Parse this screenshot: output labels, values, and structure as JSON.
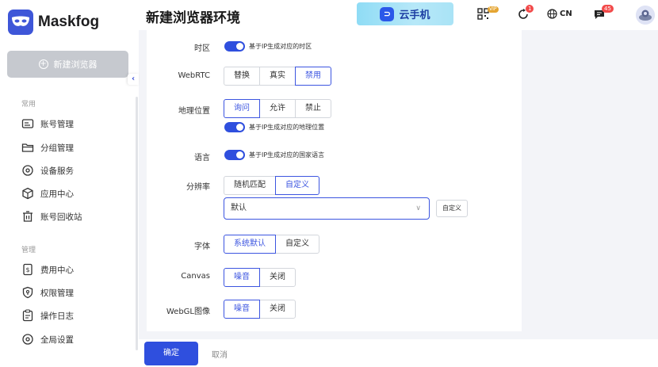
{
  "app": {
    "name": "Maskfog"
  },
  "sidebar": {
    "new_button": "新建浏览器",
    "sections": [
      {
        "title": "常用",
        "items": [
          "账号管理",
          "分组管理",
          "设备服务",
          "应用中心",
          "账号回收站"
        ]
      },
      {
        "title": "管理",
        "items": [
          "费用中心",
          "权限管理",
          "操作日志",
          "全局设置"
        ]
      }
    ]
  },
  "header": {
    "title": "新建浏览器环境",
    "cloud_phone": "云手机",
    "vip_badge": "VIP",
    "notify_badge": "1",
    "message_badge": "45",
    "language": "CN"
  },
  "form": {
    "timezone": {
      "label": "时区",
      "toggle_text": "基于IP生成对应的时区"
    },
    "webrtc": {
      "label": "WebRTC",
      "options": [
        "替换",
        "真实",
        "禁用"
      ],
      "selected": "禁用"
    },
    "geo": {
      "label": "地理位置",
      "options": [
        "询问",
        "允许",
        "禁止"
      ],
      "selected": "询问",
      "toggle_text": "基于IP生成对应的地理位置"
    },
    "language": {
      "label": "语言",
      "toggle_text": "基于IP生成对应的国家语言"
    },
    "resolution": {
      "label": "分辨率",
      "options": [
        "随机匹配",
        "自定义"
      ],
      "selected": "自定义",
      "select_value": "默认",
      "custom_button": "自定义"
    },
    "font": {
      "label": "字体",
      "options": [
        "系统默认",
        "自定义"
      ],
      "selected": "系统默认"
    },
    "canvas": {
      "label": "Canvas",
      "options": [
        "噪音",
        "关闭"
      ],
      "selected": "噪音"
    },
    "webgl": {
      "label": "WebGL图像",
      "options": [
        "噪音",
        "关闭"
      ],
      "selected": "噪音"
    }
  },
  "footer": {
    "ok": "确定",
    "cancel": "取消"
  },
  "colors": {
    "primary": "#2f4fde",
    "disabled_button": "#c6c9cf",
    "badge_red": "#f24a4a"
  }
}
